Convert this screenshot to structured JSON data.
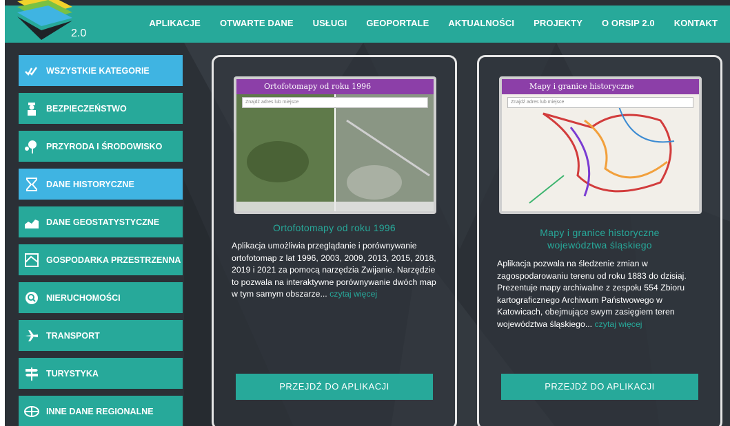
{
  "header": {
    "logo_version": "2.0",
    "nav": [
      "APLIKACJE",
      "OTWARTE DANE",
      "USŁUGI",
      "GEOPORTALE",
      "AKTUALNOŚCI",
      "PROJEKTY",
      "O ORSIP 2.0",
      "KONTAKT"
    ]
  },
  "sidebar": {
    "items": [
      {
        "label": "WSZYSTKIE KATEGORIE",
        "icon": "checkmarks-icon",
        "active": true
      },
      {
        "label": "BEZPIECZEŃSTWO",
        "icon": "police-officer-icon"
      },
      {
        "label": "PRZYRODA I ŚRODOWISKO",
        "icon": "tree-icon"
      },
      {
        "label": "DANE HISTORYCZNE",
        "icon": "hourglass-icon",
        "active": true
      },
      {
        "label": "DANE GEOSTATYSTYCZNE",
        "icon": "area-chart-icon"
      },
      {
        "label": "GOSPODARKA PRZESTRZENNA",
        "icon": "map-plan-icon"
      },
      {
        "label": "NIERUCHOMOŚCI",
        "icon": "house-search-icon"
      },
      {
        "label": "TRANSPORT",
        "icon": "airplane-icon"
      },
      {
        "label": "TURYSTYKA",
        "icon": "signpost-icon"
      },
      {
        "label": "INNE DANE REGIONALNE",
        "icon": "globe-icon"
      }
    ]
  },
  "cards": [
    {
      "screenshot_title": "Ortofotomapy od roku 1996",
      "screenshot_search": "Znajdź adres lub miejsce",
      "title": "Ortofotomapy od roku 1996",
      "text": "Aplikacja umożliwia przeglądanie i porównywanie ortofotomap z lat 1996, 2003, 2009, 2013, 2015, 2018, 2019 i 2021 za pomocą narzędzia Zwijanie. Narzędzie to pozwala na interaktywne porównywanie dwóch map w tym samym obszarze...",
      "more": "czytaj więcej",
      "button": "PRZEJDŹ DO APLIKACJI"
    },
    {
      "screenshot_title": "Mapy i granice historyczne",
      "screenshot_search": "Znajdź adres lub miejsce",
      "title_line1": "Mapy i granice historyczne",
      "title_line2": "województwa śląskiego",
      "text": "Aplikacja pozwala na śledzenie zmian w zagospodarowaniu terenu od roku 1883 do dzisiaj. Prezentuje mapy archiwalne z zespołu 554 Zbioru kartograficznego Archiwum Państwowego w Katowicach, obejmujące swym zasięgiem teren województwa śląskiego...",
      "more": "czytaj więcej",
      "button": "PRZEJDŹ DO APLIKACJI"
    }
  ],
  "colors": {
    "teal": "#27a99a",
    "blue": "#3fb4e2",
    "dark": "#2b3036",
    "purple": "#8c3fa8"
  }
}
